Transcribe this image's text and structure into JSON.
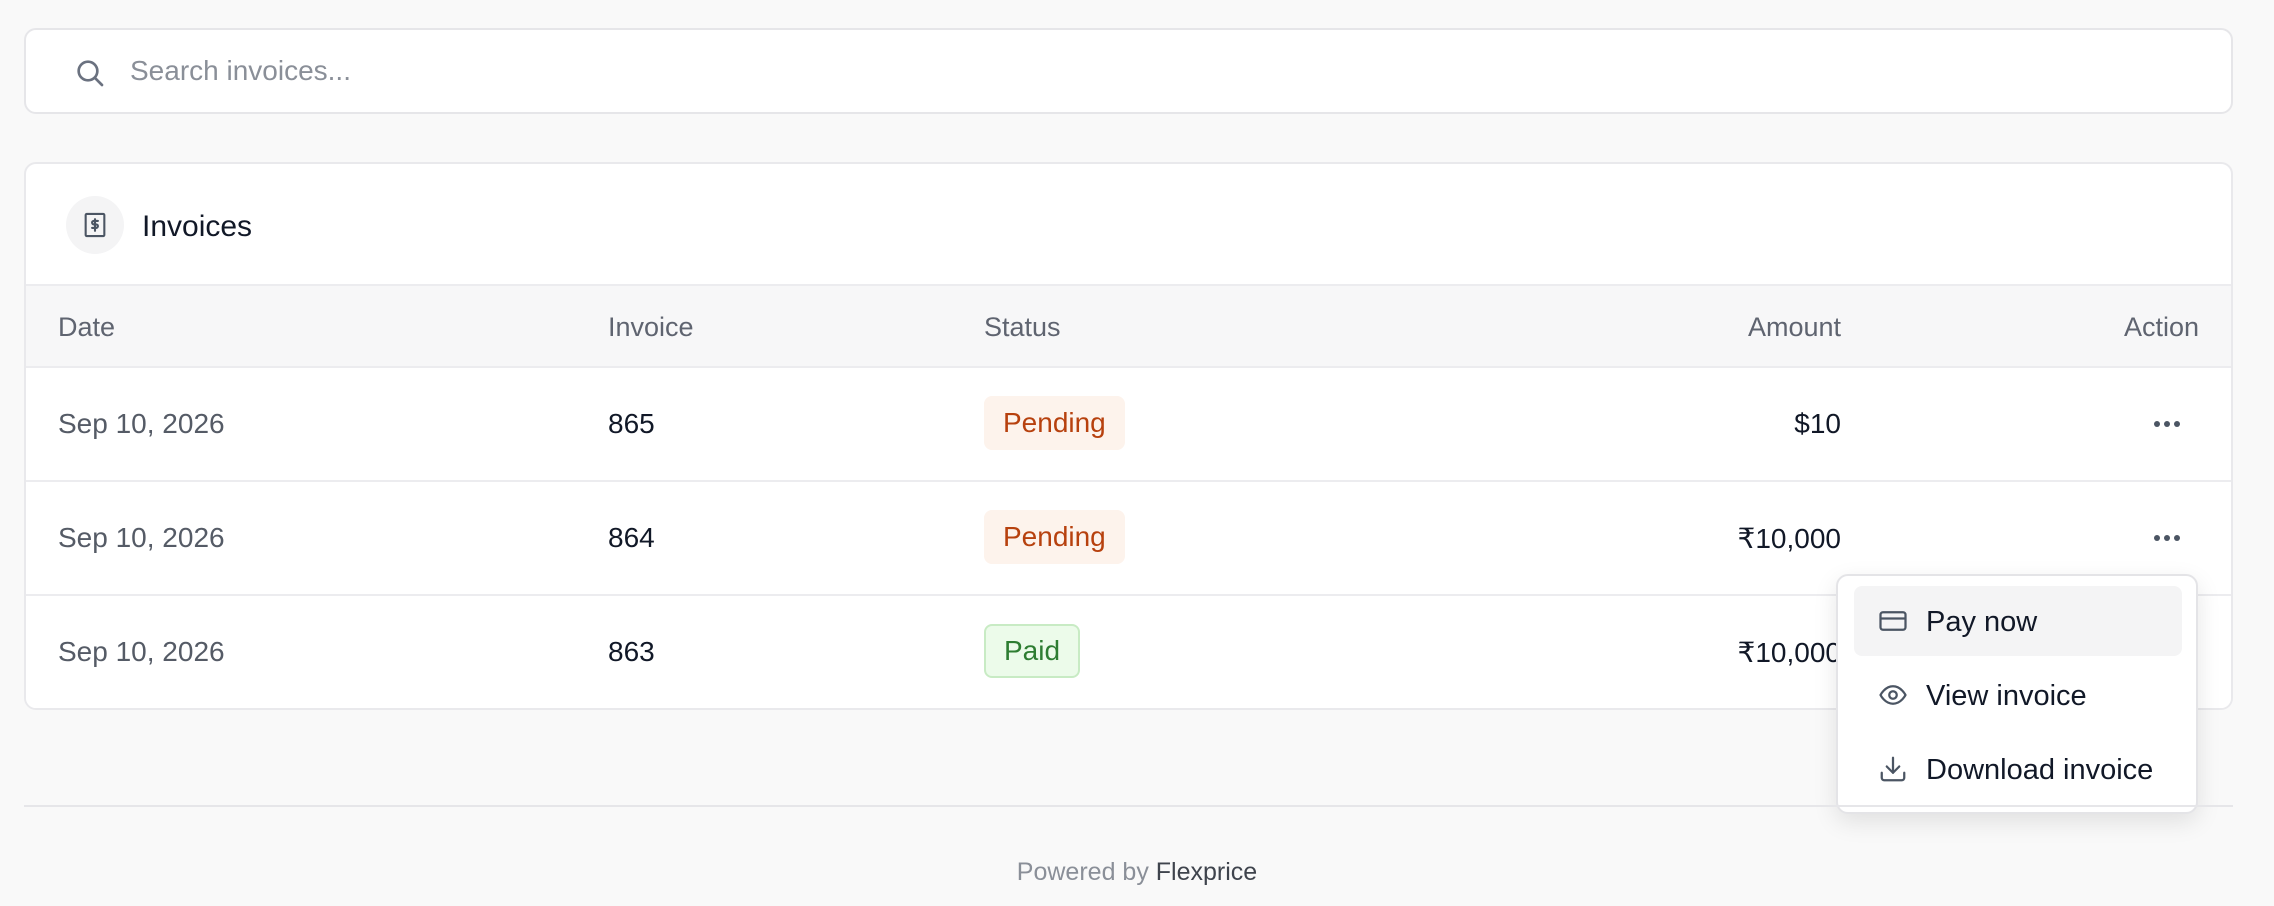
{
  "search": {
    "placeholder": "Search invoices..."
  },
  "card": {
    "title": "Invoices"
  },
  "table": {
    "headers": {
      "date": "Date",
      "invoice": "Invoice",
      "status": "Status",
      "amount": "Amount",
      "action": "Action"
    },
    "rows": [
      {
        "date": "Sep 10, 2026",
        "invoice": "865",
        "status": "Pending",
        "amount": "$10"
      },
      {
        "date": "Sep 10, 2026",
        "invoice": "864",
        "status": "Pending",
        "amount": "₹10,000"
      },
      {
        "date": "Sep 10, 2026",
        "invoice": "863",
        "status": "Paid",
        "amount": "₹10,000"
      }
    ]
  },
  "menu": {
    "items": [
      {
        "label": "Pay now",
        "icon": "credit-card-icon"
      },
      {
        "label": "View invoice",
        "icon": "eye-icon"
      },
      {
        "label": "Download invoice",
        "icon": "download-icon"
      }
    ]
  },
  "footer": {
    "prefix": "Powered by",
    "brand": "Flexprice"
  },
  "colors": {
    "pending_bg": "#fdf3ec",
    "pending_text": "#b7410e",
    "paid_bg": "#ecfbea",
    "paid_text": "#2e7d32"
  }
}
